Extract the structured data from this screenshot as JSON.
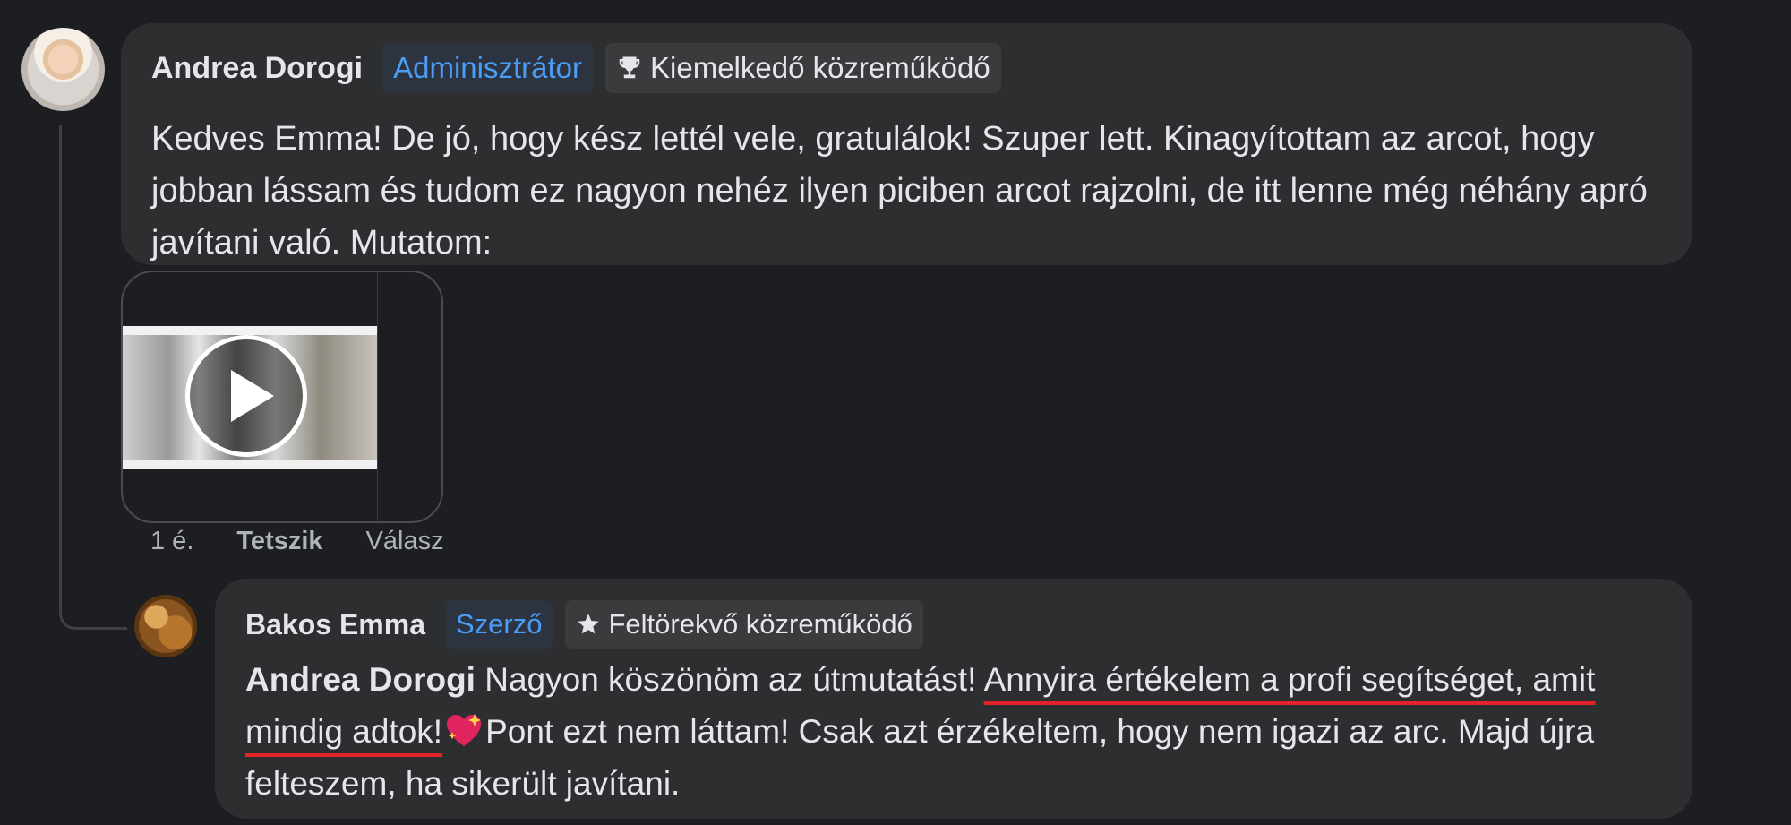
{
  "comments": [
    {
      "author": "Andrea Dorogi",
      "role_badge": "Adminisztrátor",
      "contributor_badge": "Kiemelkedő közreműködő",
      "contributor_icon": "trophy-icon",
      "text": "Kedves Emma! De jó, hogy kész lettél vele, gratulálok! Szuper lett. Kinagyítottam az arcot, hogy jobban lássam és tudom ez nagyon nehéz ilyen piciben arcot rajzolni, de itt lenne még néhány apró javítani való. Mutatom:",
      "attachment": {
        "type": "video",
        "icon": "play-icon"
      },
      "actions": {
        "time": "1 é.",
        "like": "Tetszik",
        "reply": "Válasz"
      }
    },
    {
      "author": "Bakos Emma",
      "role_badge": "Szerző",
      "contributor_badge": "Feltörekvő közreműködő",
      "contributor_icon": "star-icon",
      "mention": "Andrea Dorogi",
      "text_part1": " Nagyon köszönöm az útmutatást! ",
      "text_underlined": "Annyira értékelem a profi segítséget, amit mindig adtok!",
      "emoji": "sparkling-heart-icon",
      "text_part2": "Pont ezt nem láttam! Csak azt érzékeltem, hogy nem igazi az arc. Majd újra felteszem, ha sikerült javítani."
    }
  ],
  "colors": {
    "background": "#1c1e21",
    "bubble": "#2d2e30",
    "role_badge_text": "#4b9cf5",
    "underline": "#e3242b"
  }
}
